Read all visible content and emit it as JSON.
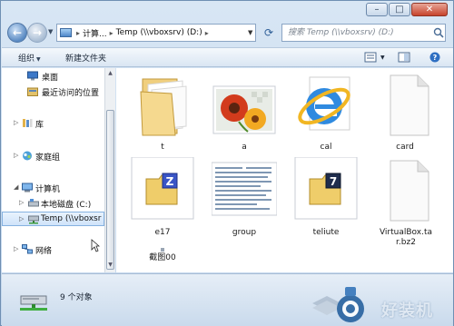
{
  "window": {
    "minimize_glyph": "–",
    "maximize_glyph": "□",
    "close_glyph": "✕"
  },
  "address": {
    "crumbs": [
      "计算...",
      "Temp (\\\\vboxsrv) (D:)"
    ],
    "back_icon": "back-arrow-icon",
    "forward_icon": "forward-arrow-icon"
  },
  "search": {
    "placeholder": "搜索 Temp (\\\\vboxsrv) (D:)"
  },
  "toolbar": {
    "organize_label": "组织",
    "new_folder_label": "新建文件夹"
  },
  "nav": {
    "items": [
      {
        "label": "桌面",
        "icon": "desktop-icon"
      },
      {
        "label": "最近访问的位置",
        "icon": "recent-places-icon"
      },
      {
        "label": "库",
        "icon": "library-icon"
      },
      {
        "label": "家庭组",
        "icon": "homegroup-icon"
      },
      {
        "label": "计算机",
        "icon": "computer-icon"
      },
      {
        "label": "本地磁盘 (C:)",
        "icon": "local-disk-icon"
      },
      {
        "label": "Temp (\\\\vboxsr",
        "icon": "network-drive-icon"
      },
      {
        "label": "网络",
        "icon": "network-icon"
      }
    ]
  },
  "files": [
    {
      "name": "t",
      "icon": "folder-icon"
    },
    {
      "name": "a",
      "icon": "image-flowers-icon"
    },
    {
      "name": "cal",
      "icon": "internet-explorer-icon"
    },
    {
      "name": "card",
      "icon": "blank-document-icon"
    },
    {
      "name": "e17",
      "icon": "zip-archive-icon"
    },
    {
      "name": "group",
      "icon": "text-document-thumbnail-icon"
    },
    {
      "name": "teliute",
      "icon": "7z-archive-icon"
    },
    {
      "name": "VirtualBox.tar.bz2",
      "icon": "blank-document-icon"
    },
    {
      "name": "截图00",
      "icon": "small-image-icon"
    }
  ],
  "status": {
    "count_text": "9 个对象"
  },
  "watermark": {
    "text": "好装机"
  },
  "colors": {
    "selection": "#cfe3fa",
    "accent": "#2f5f98"
  }
}
